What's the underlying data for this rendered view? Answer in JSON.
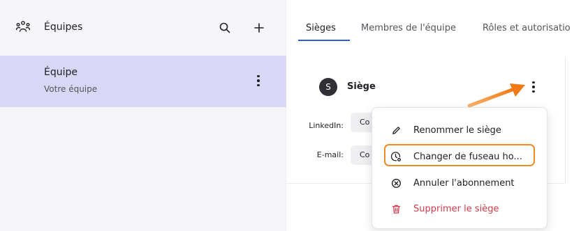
{
  "sidebar": {
    "title": "Équipes",
    "team": {
      "name": "Équipe",
      "subtitle": "Votre équipe"
    }
  },
  "tabs": [
    {
      "label": "Sièges",
      "active": true
    },
    {
      "label": "Membres de l'équipe",
      "active": false
    },
    {
      "label": "Rôles et autorisatio",
      "active": false
    }
  ],
  "seat": {
    "avatar_letter": "S",
    "title": "Siège",
    "fields": [
      {
        "label": "LinkedIn:",
        "value": "Co"
      },
      {
        "label": "E-mail:",
        "value": "Co"
      }
    ]
  },
  "menu": {
    "items": [
      {
        "label": "Renommer le siège",
        "icon": "pencil-icon"
      },
      {
        "label": "Changer de fuseau ho...",
        "icon": "clock-timezone-icon",
        "highlighted": true
      },
      {
        "label": "Annuler l'abonnement",
        "icon": "cancel-circle-icon"
      },
      {
        "label": "Supprimer le siège",
        "icon": "trash-icon",
        "danger": true
      }
    ]
  },
  "colors": {
    "accent": "#2f5fd0",
    "selected_bg": "#d8d7f6",
    "highlight": "#f08a24",
    "danger": "#d23c4c"
  }
}
